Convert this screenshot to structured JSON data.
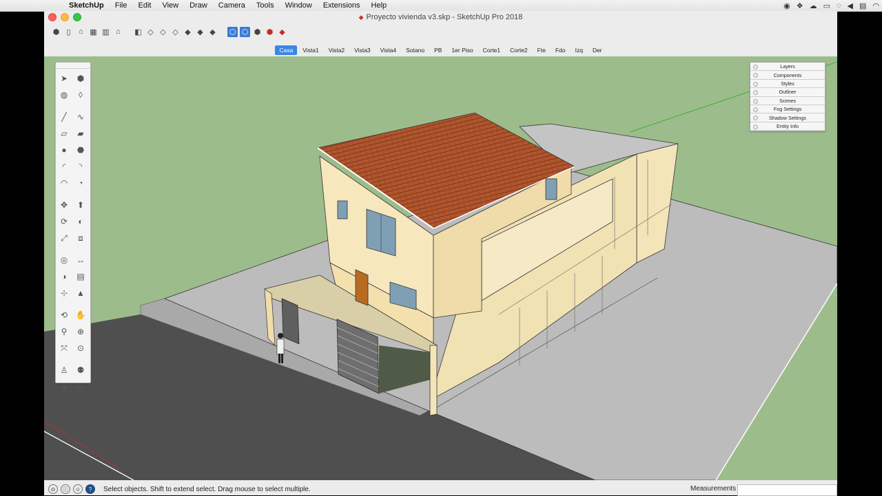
{
  "menubar": {
    "app_name": "SketchUp",
    "items": [
      "File",
      "Edit",
      "View",
      "Draw",
      "Camera",
      "Tools",
      "Window",
      "Extensions",
      "Help"
    ],
    "status_icons": [
      "record-icon",
      "dropbox-icon",
      "cloud-icon",
      "airplay-icon",
      "sync-icon",
      "volume-icon",
      "flag-icon",
      "wifi-icon"
    ]
  },
  "window": {
    "title": "Proyecto vivienda v3.skp - SketchUp Pro 2018"
  },
  "toolbar": {
    "icons": [
      "select-tool-icon",
      "new-file-icon",
      "home-icon",
      "warehouse-icon",
      "grid-icon",
      "house-icon",
      "front-view-icon",
      "top-view-icon",
      "iso-view-icon",
      "side-view-icon",
      "back-view-icon",
      "shaded-view-icon",
      "xray-view-icon",
      "components-icon",
      "extension-warehouse-icon",
      "send-to-layout-icon",
      "ruby-console-icon",
      "ruby-gem-icon"
    ]
  },
  "scenes": {
    "tabs": [
      "Casa",
      "Vista1",
      "Vista2",
      "Vista3",
      "Vista4",
      "Sotano",
      "PB",
      "1er Piso",
      "Corte1",
      "Corte2",
      "Fte",
      "Fdo",
      "Izq",
      "Der"
    ],
    "active": "Casa"
  },
  "tool_palette": {
    "tools": [
      [
        "select-arrow-icon",
        "make-component-icon"
      ],
      [
        "paint-bucket-icon",
        "eraser-icon"
      ],
      [
        "line-icon",
        "freehand-icon"
      ],
      [
        "rectangle-icon",
        "rotated-rectangle-icon"
      ],
      [
        "circle-icon",
        "polygon-icon"
      ],
      [
        "arc-icon",
        "two-point-arc-icon"
      ],
      [
        "three-point-arc-icon",
        "pie-icon"
      ],
      [
        "move-icon",
        "push-pull-icon"
      ],
      [
        "rotate-icon",
        "follow-me-icon"
      ],
      [
        "scale-icon",
        "offset-icon"
      ],
      [
        "tape-measure-icon",
        "dimension-icon"
      ],
      [
        "protractor-icon",
        "text-icon"
      ],
      [
        "axes-icon",
        "3d-text-icon"
      ],
      [
        "orbit-icon",
        "pan-icon"
      ],
      [
        "zoom-icon",
        "zoom-window-icon"
      ],
      [
        "zoom-extents-icon",
        "previous-view-icon"
      ],
      [
        "position-camera-icon",
        "walk-icon"
      ],
      [
        "look-around-icon",
        "section-plane-icon"
      ]
    ]
  },
  "trays": [
    "Layers",
    "Components",
    "Styles",
    "Outliner",
    "Scenes",
    "Fog Settings",
    "Shadow Settings",
    "Entity Info"
  ],
  "statusbar": {
    "hint": "Select objects. Shift to extend select. Drag mouse to select multiple.",
    "measurements_label": "Measurements",
    "measurements_value": ""
  },
  "colors": {
    "viewport_bg": "#9dbc8c",
    "roof": "#b0562e",
    "wall": "#f3e5b8",
    "ground": "#bcbcbc",
    "road": "#4f4f4f",
    "active_scene": "#3a86e8",
    "axis_green": "#22b022",
    "axis_red": "#cc2a2a"
  }
}
